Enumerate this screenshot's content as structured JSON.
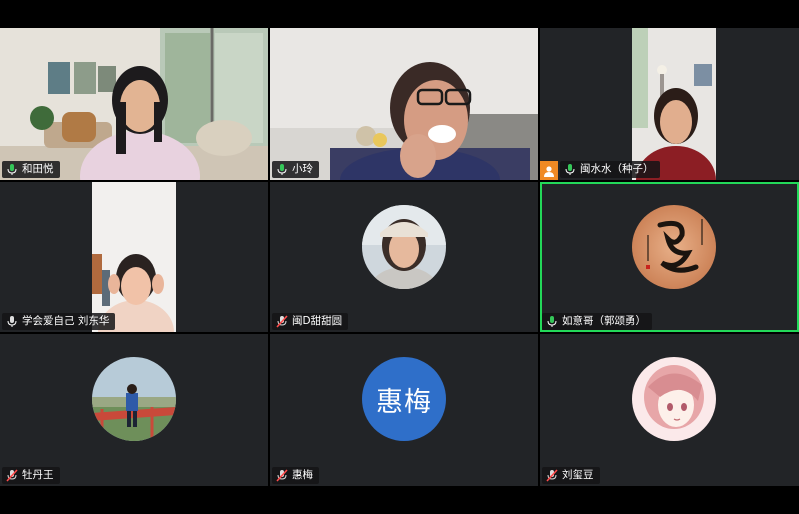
{
  "participants": [
    {
      "name": "和田悦",
      "mic": "on"
    },
    {
      "name": "小玲",
      "mic": "on"
    },
    {
      "name": "闽水水（种子）",
      "mic": "on"
    },
    {
      "name": "学会爱自己 刘东华",
      "mic": "on"
    },
    {
      "name": "闽D甜甜圆",
      "mic": "muted"
    },
    {
      "name": "如意哥（郭颂勇）",
      "mic": "on",
      "active_speaker": true
    },
    {
      "name": "牡丹王",
      "mic": "muted"
    },
    {
      "name": "惠梅",
      "mic": "muted",
      "avatar_text": "惠梅"
    },
    {
      "name": "刘玺豆",
      "mic": "muted"
    }
  ],
  "colors": {
    "active_border": "#23d959",
    "mic_on": "#35c759",
    "mic_muted": "#ff4b4b",
    "avatar_blue": "#2f6fc9",
    "user_badge": "#f08a24"
  }
}
